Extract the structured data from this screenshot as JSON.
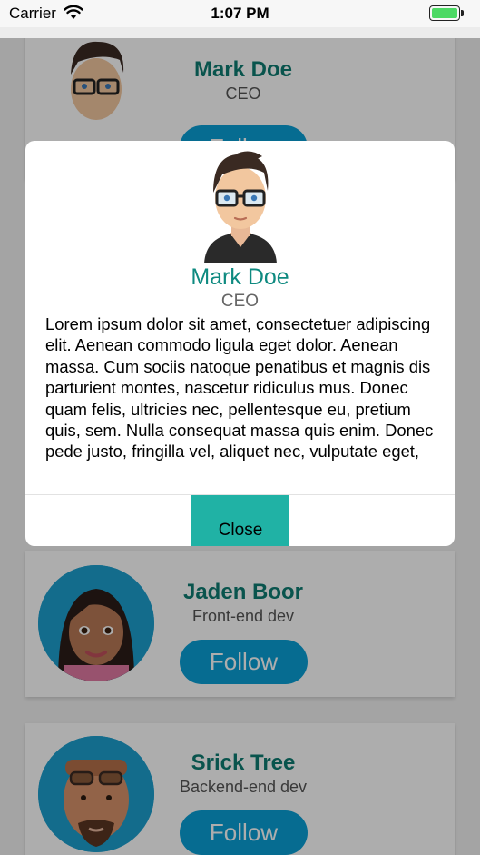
{
  "status_bar": {
    "carrier": "Carrier",
    "time": "1:07 PM",
    "battery_level": 1.0
  },
  "cards": [
    {
      "name": "Mark Doe",
      "role": "CEO",
      "follow_label": "Follow"
    },
    {
      "name": "Jaden Boor",
      "role": "Front-end dev",
      "follow_label": "Follow"
    },
    {
      "name": "Srick Tree",
      "role": "Backend-end dev",
      "follow_label": "Follow"
    }
  ],
  "modal": {
    "name": "Mark Doe",
    "role": "CEO",
    "body": "Lorem ipsum dolor sit amet, consectetuer adipiscing elit. Aenean commodo ligula eget dolor. Aenean massa. Cum sociis natoque penatibus et magnis dis parturient montes, nascetur ridiculus mus. Donec quam felis, ultricies nec, pellentesque eu, pretium quis, sem. Nulla consequat massa quis enim. Donec pede justo, fringilla vel, aliquet nec, vulputate eget, arcu.",
    "close_label": "Close"
  },
  "colors": {
    "accent_teal": "#0e7c72",
    "follow_blue": "#0aa0d6",
    "close_teal": "#20b2a5",
    "battery_green": "#4cd964"
  }
}
